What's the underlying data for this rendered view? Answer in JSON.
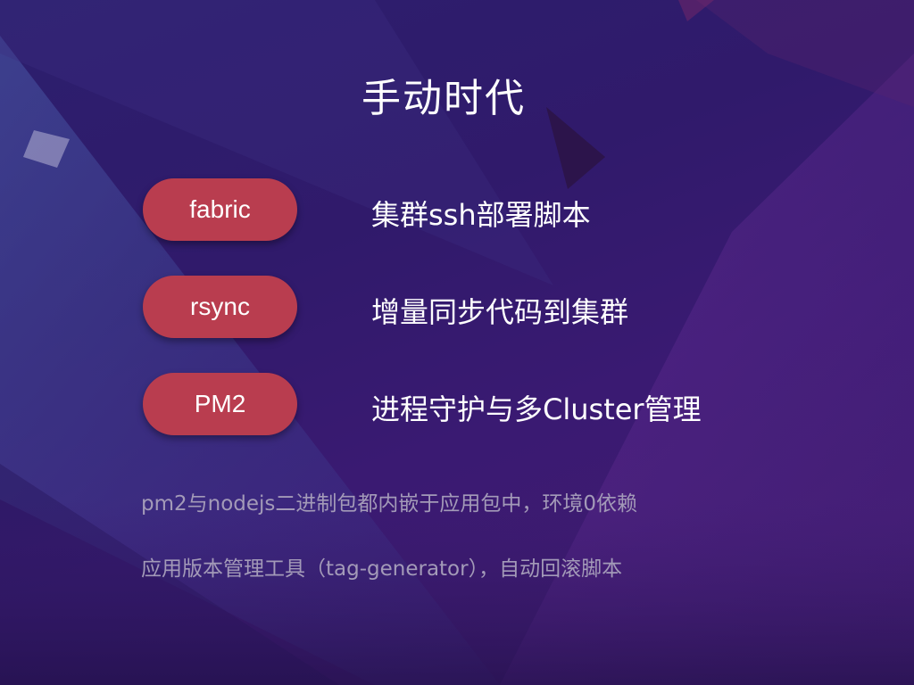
{
  "slide": {
    "title": "手动时代",
    "tools": [
      {
        "name": "fabric",
        "description": "集群ssh部署脚本"
      },
      {
        "name": "rsync",
        "description": "增量同步代码到集群"
      },
      {
        "name": "PM2",
        "description": "进程守护与多Cluster管理"
      }
    ],
    "notes": [
      "pm2与nodejs二进制包都内嵌于应用包中，环境0依赖",
      "应用版本管理工具（tag-generator），自动回滚脚本"
    ]
  },
  "colors": {
    "pill": "#b93d4f",
    "text": "#ffffff",
    "note_text": "#a39ab8"
  }
}
